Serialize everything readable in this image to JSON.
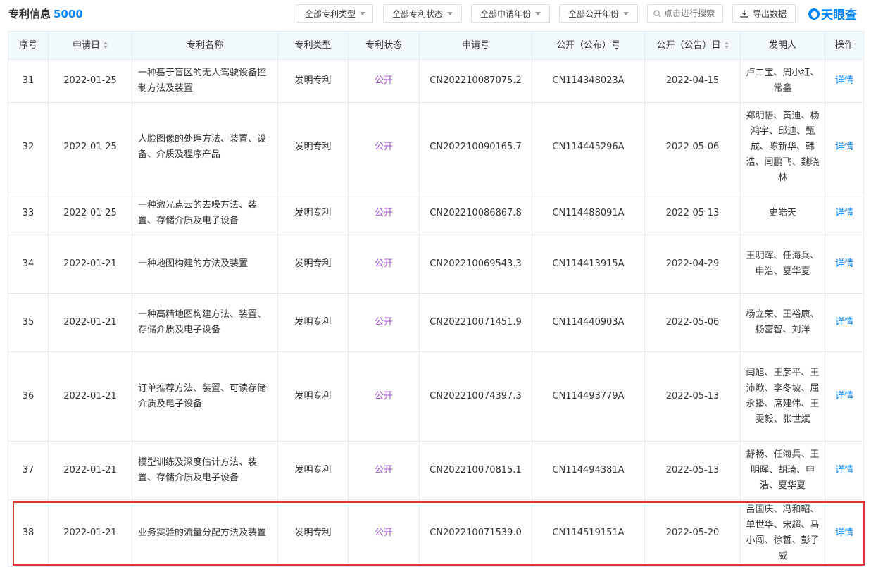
{
  "header": {
    "title": "专利信息",
    "count": "5000",
    "filters": [
      "全部专利类型",
      "全部专利状态",
      "全部申请年份",
      "全部公开年份"
    ],
    "search_placeholder": "点击进行搜索",
    "export_label": "导出数据",
    "logo_text": "天眼查"
  },
  "table": {
    "columns": [
      "序号",
      "申请日",
      "专利名称",
      "专利类型",
      "专利状态",
      "申请号",
      "公开（公布）号",
      "公开（公告）日",
      "发明人",
      "操作"
    ],
    "rows": [
      {
        "no": "31",
        "apply_date": "2022-01-25",
        "name": "一种基于盲区的无人驾驶设备控制方法及装置",
        "type": "发明专利",
        "status": "公开",
        "app_no": "CN202210087075.2",
        "pub_no": "CN114348023A",
        "pub_date": "2022-04-15",
        "inventors": "卢二宝、周小红、常鑫",
        "action": "详情"
      },
      {
        "no": "32",
        "apply_date": "2022-01-25",
        "name": "人脸图像的处理方法、装置、设备、介质及程序产品",
        "type": "发明专利",
        "status": "公开",
        "app_no": "CN202210090165.7",
        "pub_no": "CN114445296A",
        "pub_date": "2022-05-06",
        "inventors": "郑明悟、黄迪、杨鸿宇、邱迪、甄成、陈新华、韩浩、闫鹏飞、魏晓林",
        "action": "详情"
      },
      {
        "no": "33",
        "apply_date": "2022-01-25",
        "name": "一种激光点云的去噪方法、装置、存储介质及电子设备",
        "type": "发明专利",
        "status": "公开",
        "app_no": "CN202210086867.8",
        "pub_no": "CN114488091A",
        "pub_date": "2022-05-13",
        "inventors": "史皓天",
        "action": "详情"
      },
      {
        "no": "34",
        "apply_date": "2022-01-21",
        "name": "一种地图构建的方法及装置",
        "type": "发明专利",
        "status": "公开",
        "app_no": "CN202210069543.3",
        "pub_no": "CN114413915A",
        "pub_date": "2022-04-29",
        "inventors": "王明晖、任海兵、申浩、夏华夏",
        "action": "详情"
      },
      {
        "no": "35",
        "apply_date": "2022-01-21",
        "name": "一种高精地图构建方法、装置、存储介质及电子设备",
        "type": "发明专利",
        "status": "公开",
        "app_no": "CN202210071451.9",
        "pub_no": "CN114440903A",
        "pub_date": "2022-05-06",
        "inventors": "杨立荣、王裕康、杨富智、刘洋",
        "action": "详情"
      },
      {
        "no": "36",
        "apply_date": "2022-01-21",
        "name": "订单推荐方法、装置、可读存储介质及电子设备",
        "type": "发明专利",
        "status": "公开",
        "app_no": "CN202210074397.3",
        "pub_no": "CN114493779A",
        "pub_date": "2022-05-13",
        "inventors": "闫旭、王彦平、王沛焮、李冬坡、屈永播、席建伟、王雯毅、张世斌",
        "action": "详情"
      },
      {
        "no": "37",
        "apply_date": "2022-01-21",
        "name": "模型训练及深度估计方法、装置、存储介质及电子设备",
        "type": "发明专利",
        "status": "公开",
        "app_no": "CN202210070815.1",
        "pub_no": "CN114494381A",
        "pub_date": "2022-05-13",
        "inventors": "舒畅、任海兵、王明晖、胡琦、申浩、夏华夏",
        "action": "详情"
      },
      {
        "no": "38",
        "apply_date": "2022-01-21",
        "name": "业务实验的流量分配方法及装置",
        "type": "发明专利",
        "status": "公开",
        "app_no": "CN202210071539.0",
        "pub_no": "CN114519151A",
        "pub_date": "2022-05-20",
        "inventors": "吕国庆、冯和昭、单世华、宋超、马小闯、徐哲、彭子威",
        "action": "详情"
      }
    ]
  },
  "colors": {
    "accent": "#0084ff",
    "status": "#9c4dcc",
    "highlight": "#e03434",
    "header_bg": "#f2f9fc"
  }
}
